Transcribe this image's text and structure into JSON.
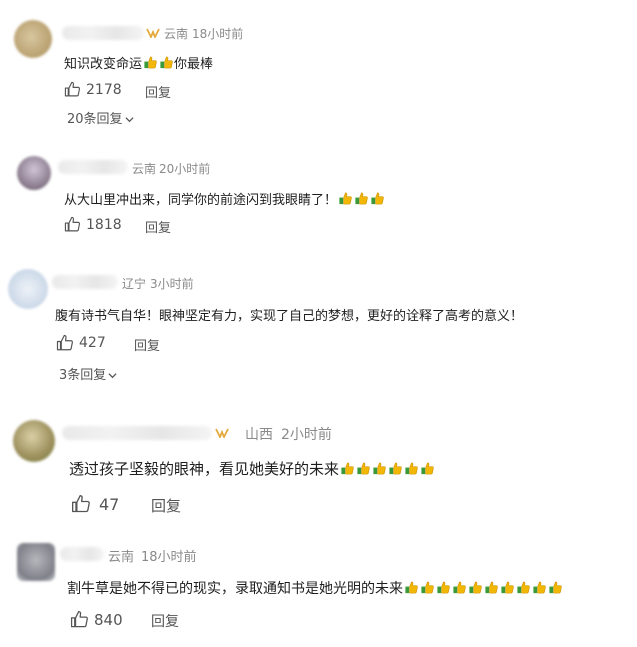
{
  "colors": {
    "text": "#1e1e1e",
    "meta": "#8a8a8a",
    "action": "#555555",
    "thumb_emoji": "#f2b705",
    "thumb_cuff": "#3a9a3a"
  },
  "comments": [
    {
      "location": "云南",
      "time": "18小时前",
      "text": "知识改变命运",
      "emoji_inline": 2,
      "text_after": "你最棒",
      "emoji_after": 0,
      "likes": "2178",
      "reply": "回复",
      "more": "20条回复"
    },
    {
      "location": "云南",
      "time": "20小时前",
      "text": "从大山里冲出来，同学你的前途闪到我眼睛了！",
      "emoji_inline": 0,
      "text_after": "",
      "emoji_after": 3,
      "likes": "1818",
      "reply": "回复",
      "more": ""
    },
    {
      "location": "辽宁",
      "time": "3小时前",
      "text": "腹有诗书气自华！眼神坚定有力，实现了自己的梦想，更好的诠释了高考的意义！",
      "emoji_inline": 0,
      "text_after": "",
      "emoji_after": 0,
      "likes": "427",
      "reply": "回复",
      "more": "3条回复"
    },
    {
      "location": "山西",
      "time": "2小时前",
      "text": "透过孩子坚毅的眼神，看见她美好的未来",
      "emoji_inline": 0,
      "text_after": "",
      "emoji_after": 6,
      "likes": "47",
      "reply": "回复",
      "more": ""
    },
    {
      "location": "云南",
      "time": "18小时前",
      "text": "割牛草是她不得已的现实，录取通知书是她光明的未来",
      "emoji_inline": 0,
      "text_after": "",
      "emoji_after": 10,
      "likes": "840",
      "reply": "回复",
      "more": ""
    }
  ]
}
